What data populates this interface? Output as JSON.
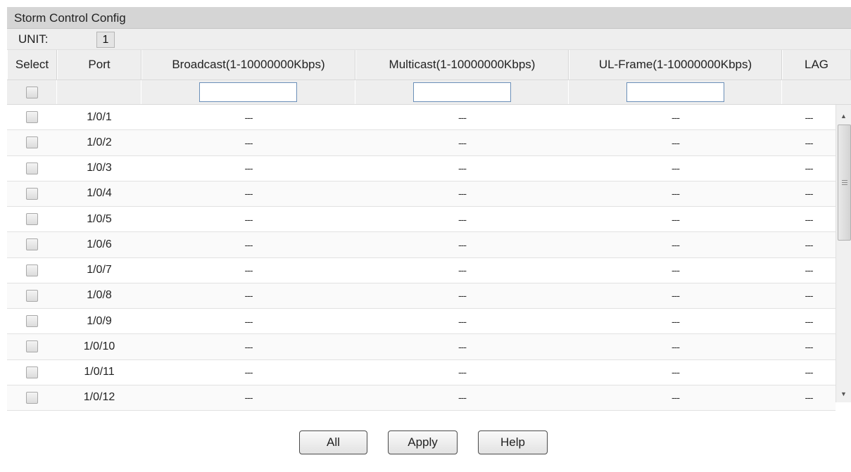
{
  "panel": {
    "title": "Storm Control Config",
    "unit_label": "UNIT:",
    "unit_value": "1"
  },
  "columns": {
    "select": "Select",
    "port": "Port",
    "broadcast": "Broadcast(1-10000000Kbps)",
    "multicast": "Multicast(1-10000000Kbps)",
    "ul_frame": "UL-Frame(1-10000000Kbps)",
    "lag": "LAG"
  },
  "filter": {
    "broadcast_value": "",
    "multicast_value": "",
    "ul_frame_value": ""
  },
  "rows": [
    {
      "port": "1/0/1",
      "broadcast": "---",
      "multicast": "---",
      "ul_frame": "---",
      "lag": "---",
      "selected": false
    },
    {
      "port": "1/0/2",
      "broadcast": "---",
      "multicast": "---",
      "ul_frame": "---",
      "lag": "---",
      "selected": false
    },
    {
      "port": "1/0/3",
      "broadcast": "---",
      "multicast": "---",
      "ul_frame": "---",
      "lag": "---",
      "selected": false
    },
    {
      "port": "1/0/4",
      "broadcast": "---",
      "multicast": "---",
      "ul_frame": "---",
      "lag": "---",
      "selected": false
    },
    {
      "port": "1/0/5",
      "broadcast": "---",
      "multicast": "---",
      "ul_frame": "---",
      "lag": "---",
      "selected": false
    },
    {
      "port": "1/0/6",
      "broadcast": "---",
      "multicast": "---",
      "ul_frame": "---",
      "lag": "---",
      "selected": false
    },
    {
      "port": "1/0/7",
      "broadcast": "---",
      "multicast": "---",
      "ul_frame": "---",
      "lag": "---",
      "selected": false
    },
    {
      "port": "1/0/8",
      "broadcast": "---",
      "multicast": "---",
      "ul_frame": "---",
      "lag": "---",
      "selected": false
    },
    {
      "port": "1/0/9",
      "broadcast": "---",
      "multicast": "---",
      "ul_frame": "---",
      "lag": "---",
      "selected": false
    },
    {
      "port": "1/0/10",
      "broadcast": "---",
      "multicast": "---",
      "ul_frame": "---",
      "lag": "---",
      "selected": false
    },
    {
      "port": "1/0/11",
      "broadcast": "---",
      "multicast": "---",
      "ul_frame": "---",
      "lag": "---",
      "selected": false
    },
    {
      "port": "1/0/12",
      "broadcast": "---",
      "multicast": "---",
      "ul_frame": "---",
      "lag": "---",
      "selected": false
    }
  ],
  "buttons": {
    "all": "All",
    "apply": "Apply",
    "help": "Help"
  },
  "colors": {
    "title_bg": "#d5d5d5",
    "header_bg": "#eeeeee",
    "input_border": "#6b8fb8"
  },
  "icons": {
    "scroll_up": "triangle-up-icon",
    "scroll_down": "triangle-down-icon",
    "thumb_grip": "grip-lines-icon"
  }
}
